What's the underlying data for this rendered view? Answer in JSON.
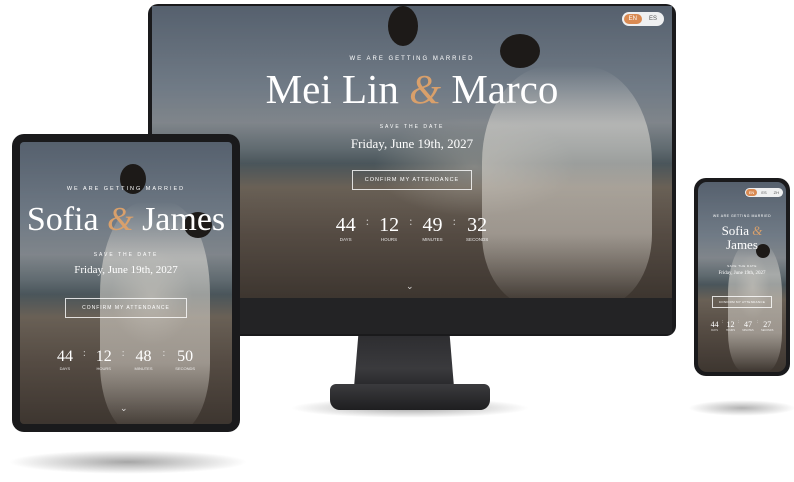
{
  "desktop": {
    "language": {
      "options": [
        "EN",
        "ES"
      ],
      "active": "EN"
    },
    "eyebrow": "We are getting married",
    "name1": "Mei Lin",
    "amp": "&",
    "name2": "Marco",
    "save_the_date": "Save the date",
    "date": "Friday, June 19th, 2027",
    "cta": "Confirm my attendance",
    "countdown": [
      {
        "value": "44",
        "label": "Days"
      },
      {
        "value": "12",
        "label": "Hours"
      },
      {
        "value": "49",
        "label": "Minutes"
      },
      {
        "value": "32",
        "label": "Seconds"
      }
    ]
  },
  "tablet": {
    "eyebrow": "We are getting married",
    "name1": "Sofia",
    "amp": "&",
    "name2": "James",
    "save_the_date": "Save the date",
    "date": "Friday, June 19th, 2027",
    "cta": "Confirm my attendance",
    "countdown": [
      {
        "value": "44",
        "label": "Days"
      },
      {
        "value": "12",
        "label": "Hours"
      },
      {
        "value": "48",
        "label": "Minutes"
      },
      {
        "value": "50",
        "label": "Seconds"
      }
    ]
  },
  "phone": {
    "language": {
      "options": [
        "EN",
        "ES",
        "ZH"
      ],
      "active": "EN"
    },
    "eyebrow": "We are getting married",
    "name1": "Sofia",
    "amp": "&",
    "name2": "James",
    "save_the_date": "Save the date",
    "date": "Friday, June 19th, 2027",
    "cta": "Confirm my attendance",
    "countdown": [
      {
        "value": "44",
        "label": "Days"
      },
      {
        "value": "12",
        "label": "Hours"
      },
      {
        "value": "47",
        "label": "Minutes"
      },
      {
        "value": "27",
        "label": "Seconds"
      }
    ]
  },
  "colors": {
    "accent": "#d98a52",
    "device": "#1a1a1c"
  },
  "icons": {
    "scroll": "chevron-down-icon"
  }
}
